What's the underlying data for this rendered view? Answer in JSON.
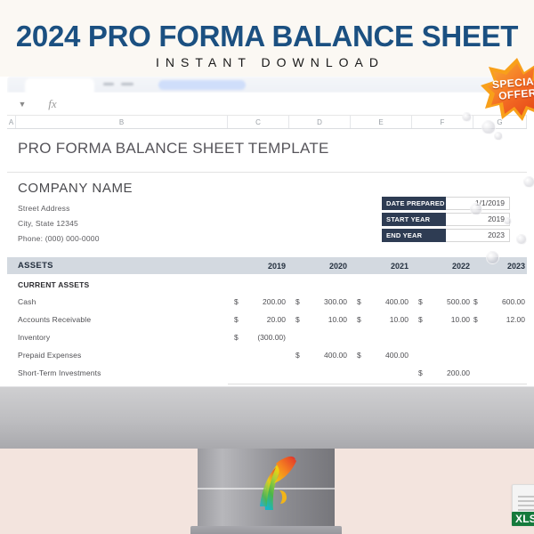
{
  "promo": {
    "title": "2024 PRO FORMA BALANCE SHEET",
    "subtitle": "INSTANT DOWNLOAD",
    "title_color": "#1b5081",
    "subtitle_color": "#191919",
    "background": "#fbf8f3"
  },
  "badge": {
    "line1": "SPECIAL",
    "line2": "OFFER",
    "fill": "#e8471e",
    "fill2": "#f8a01a"
  },
  "file_badge": {
    "label": "XLSX",
    "color": "#157a3c"
  },
  "browser": {
    "name_box_icon": "chevron-down-icon",
    "formula_icon": "fx",
    "formula_value": ""
  },
  "spreadsheet": {
    "column_headers": [
      "A",
      "B",
      "C",
      "D",
      "E",
      "F",
      "G"
    ],
    "document_title": "PRO FORMA BALANCE SHEET TEMPLATE",
    "company": {
      "name": "COMPANY NAME",
      "street": "Street Address",
      "city": "City, State  12345",
      "phone": "Phone: (000) 000-0000"
    },
    "info_box": [
      {
        "label": "DATE PREPARED",
        "value": "1/1/2019"
      },
      {
        "label": "START YEAR",
        "value": "2019"
      },
      {
        "label": "END YEAR",
        "value": "2023"
      }
    ],
    "assets_header": "ASSETS",
    "years": [
      "2019",
      "2020",
      "2021",
      "2022",
      "2023"
    ],
    "section_label": "CURRENT ASSETS",
    "rows": [
      {
        "label": "Cash",
        "cells": [
          {
            "sym": "$",
            "num": "200.00"
          },
          {
            "sym": "$",
            "num": "300.00"
          },
          {
            "sym": "$",
            "num": "400.00"
          },
          {
            "sym": "$",
            "num": "500.00"
          },
          {
            "sym": "$",
            "num": "600.00"
          }
        ]
      },
      {
        "label": "Accounts Receivable",
        "cells": [
          {
            "sym": "$",
            "num": "20.00"
          },
          {
            "sym": "$",
            "num": "10.00"
          },
          {
            "sym": "$",
            "num": "10.00"
          },
          {
            "sym": "$",
            "num": "10.00"
          },
          {
            "sym": "$",
            "num": "12.00"
          }
        ]
      },
      {
        "label": "Inventory",
        "cells": [
          {
            "sym": "$",
            "num": "(300.00)"
          },
          {
            "sym": "",
            "num": ""
          },
          {
            "sym": "",
            "num": ""
          },
          {
            "sym": "",
            "num": ""
          },
          {
            "sym": "",
            "num": ""
          }
        ]
      },
      {
        "label": "Prepaid Expenses",
        "cells": [
          {
            "sym": "",
            "num": ""
          },
          {
            "sym": "$",
            "num": "400.00"
          },
          {
            "sym": "$",
            "num": "400.00"
          },
          {
            "sym": "",
            "num": ""
          },
          {
            "sym": "",
            "num": ""
          }
        ]
      },
      {
        "label": "Short-Term Investments",
        "cells": [
          {
            "sym": "",
            "num": ""
          },
          {
            "sym": "",
            "num": ""
          },
          {
            "sym": "",
            "num": ""
          },
          {
            "sym": "$",
            "num": "200.00"
          },
          {
            "sym": "",
            "num": ""
          }
        ]
      }
    ]
  },
  "scene": {
    "desk_color": "#f3e4de",
    "monitor_chin_color": "#bdbdc0",
    "logo_name": "rainbow-swirl-logo"
  }
}
